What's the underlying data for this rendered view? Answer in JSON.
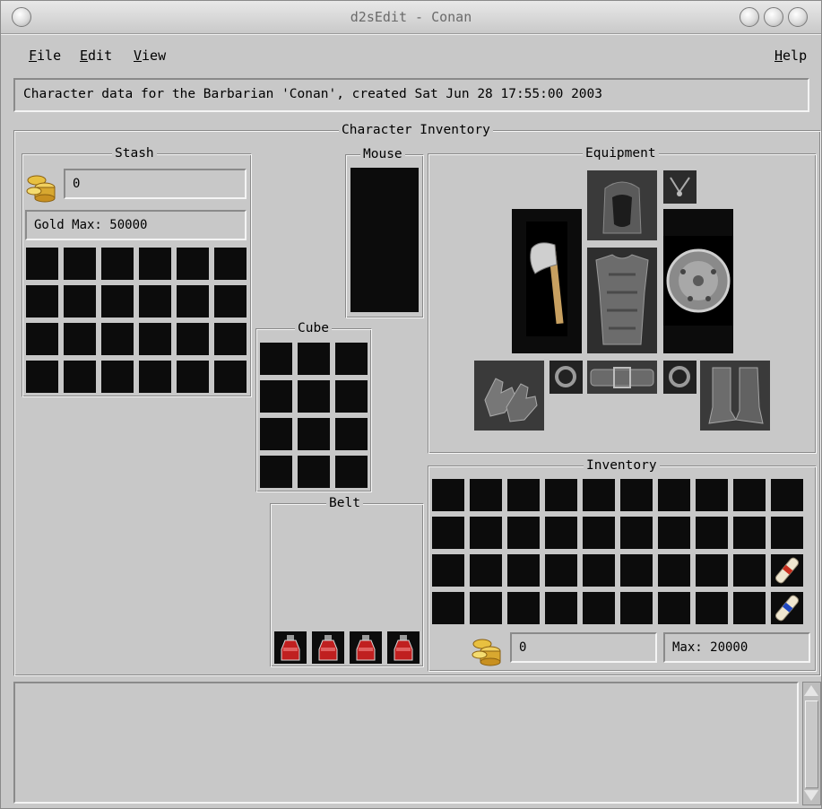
{
  "window": {
    "title": "d2sEdit - Conan"
  },
  "menubar": {
    "file": {
      "u": "F",
      "rest": "ile"
    },
    "edit": {
      "u": "E",
      "rest": "dit"
    },
    "view": {
      "u": "V",
      "rest": "iew"
    },
    "help": {
      "u": "H",
      "rest": "elp"
    }
  },
  "status_text": "Character data for the Barbarian 'Conan', created Sat Jun 28 17:55:00 2003",
  "inventory_section": {
    "label": "Character Inventory"
  },
  "stash": {
    "label": "Stash",
    "gold": "0",
    "gold_max": "Gold Max: 50000",
    "rows": 4,
    "cols": 6
  },
  "mouse": {
    "label": "Mouse"
  },
  "cube": {
    "label": "Cube",
    "rows": 4,
    "cols": 3
  },
  "belt": {
    "label": "Belt",
    "potions": [
      "healing-potion",
      "healing-potion",
      "healing-potion",
      "healing-potion"
    ]
  },
  "equipment": {
    "label": "Equipment",
    "slots": [
      "helm",
      "amulet",
      "weapon-hand-axe",
      "body-armor",
      "shield",
      "gloves",
      "ring-left",
      "belt",
      "ring-right",
      "boots"
    ]
  },
  "inventory": {
    "label": "Inventory",
    "rows": 4,
    "cols": 10,
    "gold": "0",
    "gold_max": "Max: 20000",
    "scrolls": [
      "scroll-of-identify",
      "scroll-of-town-portal"
    ]
  },
  "colors": {
    "window_bg": "#c8c8c8",
    "slot_bg": "#0c0c0c"
  }
}
